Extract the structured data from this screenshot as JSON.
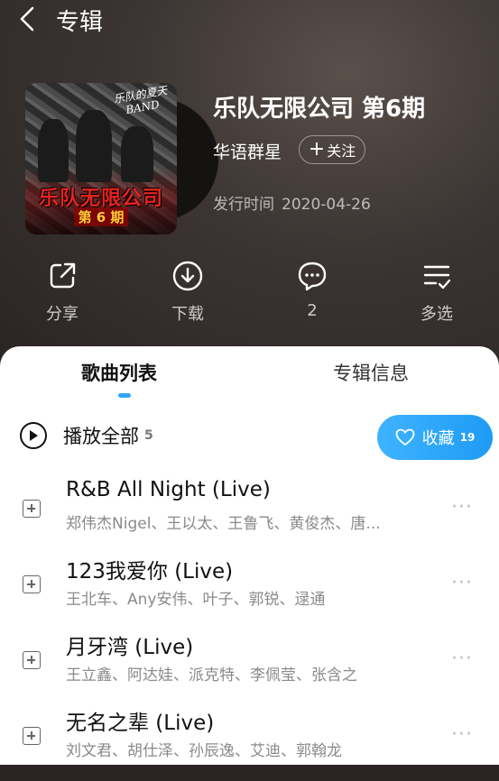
{
  "header": {
    "title": "专辑"
  },
  "album": {
    "cover_band_text": "乐队的夏天 BAND",
    "cover_title": "乐队无限公司",
    "cover_subtitle": "第 6 期",
    "title": "乐队无限公司 第6期",
    "artist": "华语群星",
    "follow_label": "关注",
    "release_label": "发行时间",
    "release_date": "2020-04-26"
  },
  "actions": [
    {
      "icon": "share-icon",
      "label": "分享"
    },
    {
      "icon": "download-icon",
      "label": "下载"
    },
    {
      "icon": "comment-icon",
      "label": "2"
    },
    {
      "icon": "multi-select-icon",
      "label": "多选"
    }
  ],
  "tabs": [
    {
      "label": "歌曲列表",
      "active": true
    },
    {
      "label": "专辑信息",
      "active": false
    }
  ],
  "play_all": {
    "label": "播放全部",
    "count": "5"
  },
  "collect": {
    "label": "收藏",
    "count": "19"
  },
  "songs": [
    {
      "name": "R&B All Night (Live)",
      "artists": "郑伟杰Nigel、王以太、王鲁飞、黄俊杰、唐..."
    },
    {
      "name": "123我爱你 (Live)",
      "artists": "王北车、Any安伟、叶子、郭锐、逯通"
    },
    {
      "name": "月牙湾 (Live)",
      "artists": "王立鑫、阿达娃、派克特、李佩莹、张含之"
    },
    {
      "name": "无名之辈 (Live)",
      "artists": "刘文君、胡仕泽、孙辰逸、艾迪、郭翰龙"
    }
  ],
  "colors": {
    "accent": "#31a5ff",
    "collect_bg": "#1e9bf5",
    "hero_bg": "#3b3432"
  }
}
